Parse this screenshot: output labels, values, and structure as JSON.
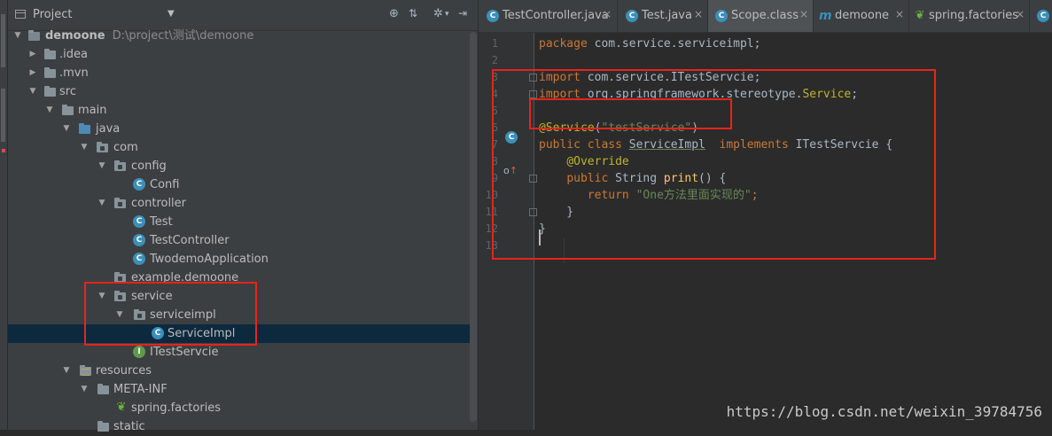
{
  "project_panel": {
    "title": "Project",
    "tree": [
      {
        "label": "demoone",
        "path": "D:\\project\\测试\\demoone",
        "icon": "module-folder-icon",
        "expanded": true
      },
      {
        "label": ".idea",
        "icon": "folder-icon",
        "expanded": false
      },
      {
        "label": ".mvn",
        "icon": "folder-icon",
        "expanded": false
      },
      {
        "label": "src",
        "icon": "folder-icon",
        "expanded": true
      },
      {
        "label": "main",
        "icon": "folder-icon",
        "expanded": true
      },
      {
        "label": "java",
        "icon": "source-folder-icon",
        "expanded": true
      },
      {
        "label": "com",
        "icon": "package-icon",
        "expanded": true
      },
      {
        "label": "config",
        "icon": "package-icon",
        "expanded": true
      },
      {
        "label": "Confi",
        "icon": "class-icon"
      },
      {
        "label": "controller",
        "icon": "package-icon",
        "expanded": true
      },
      {
        "label": "Test",
        "icon": "class-icon"
      },
      {
        "label": "TestController",
        "icon": "class-icon"
      },
      {
        "label": "TwodemoApplication",
        "icon": "spring-boot-class-icon"
      },
      {
        "label": "example.demoone",
        "icon": "package-icon",
        "expanded": false
      },
      {
        "label": "service",
        "icon": "package-icon",
        "expanded": true
      },
      {
        "label": "serviceimpl",
        "icon": "package-icon",
        "expanded": true
      },
      {
        "label": "ServiceImpl",
        "icon": "class-icon",
        "selected": true
      },
      {
        "label": "ITestServcie",
        "icon": "interface-icon"
      },
      {
        "label": "resources",
        "icon": "resources-folder-icon",
        "expanded": true
      },
      {
        "label": "META-INF",
        "icon": "folder-icon",
        "expanded": true
      },
      {
        "label": "spring.factories",
        "icon": "spring-file-icon"
      },
      {
        "label": "static",
        "icon": "folder-icon"
      }
    ]
  },
  "tabs": [
    {
      "label": "TestController.java",
      "icon": "class-icon"
    },
    {
      "label": "Test.java",
      "icon": "class-icon"
    },
    {
      "label": "Scope.class",
      "icon": "class-icon",
      "active": true
    },
    {
      "label": "demoone",
      "icon": "maven-icon"
    },
    {
      "label": "spring.factories",
      "icon": "spring-file-icon"
    }
  ],
  "tab_close": "×",
  "editor": {
    "lines": [
      {
        "n": "1",
        "tokens": [
          [
            "kw",
            "package "
          ],
          [
            "",
            "com.service.serviceimpl;"
          ]
        ]
      },
      {
        "n": "2",
        "tokens": []
      },
      {
        "n": "3",
        "tokens": [
          [
            "kw",
            "import "
          ],
          [
            "",
            "com.service.ITestServcie;"
          ]
        ]
      },
      {
        "n": "4",
        "tokens": [
          [
            "kw",
            "import "
          ],
          [
            "",
            "org.springframework.stereotype."
          ],
          [
            "an",
            "Service"
          ],
          [
            "",
            ";"
          ]
        ]
      },
      {
        "n": "5",
        "tokens": []
      },
      {
        "n": "6",
        "tokens": [
          [
            "an",
            "@Service"
          ],
          [
            "",
            "("
          ],
          [
            "st",
            "\"testService\""
          ],
          [
            "",
            ")"
          ]
        ]
      },
      {
        "n": "7",
        "tokens": [
          [
            "kw",
            "public class "
          ],
          [
            "und",
            "ServiceImpl"
          ],
          [
            "",
            "  "
          ],
          [
            "kw",
            "implements "
          ],
          [
            "",
            "ITestServcie {"
          ]
        ]
      },
      {
        "n": "8",
        "tokens": [
          [
            "",
            "    "
          ],
          [
            "an",
            "@Override"
          ]
        ]
      },
      {
        "n": "9",
        "tokens": [
          [
            "",
            "    "
          ],
          [
            "kw",
            "public "
          ],
          [
            "",
            "String "
          ],
          [
            "fn",
            "print"
          ],
          [
            "",
            "() {"
          ]
        ]
      },
      {
        "n": "10",
        "tokens": [
          [
            "",
            "       "
          ],
          [
            "kw",
            "return "
          ],
          [
            "st",
            "\"One方法里面实现的\""
          ],
          [
            "kw",
            ";"
          ]
        ]
      },
      {
        "n": "11",
        "tokens": [
          [
            "",
            "    }"
          ]
        ]
      },
      {
        "n": "12",
        "tokens": [
          [
            "",
            "}"
          ]
        ]
      },
      {
        "n": "13",
        "tokens": []
      }
    ]
  },
  "watermark": "https://blog.csdn.net/weixin_39784756",
  "colors": {
    "annotation_red": "#e8231e",
    "selection": "#0d293e"
  }
}
